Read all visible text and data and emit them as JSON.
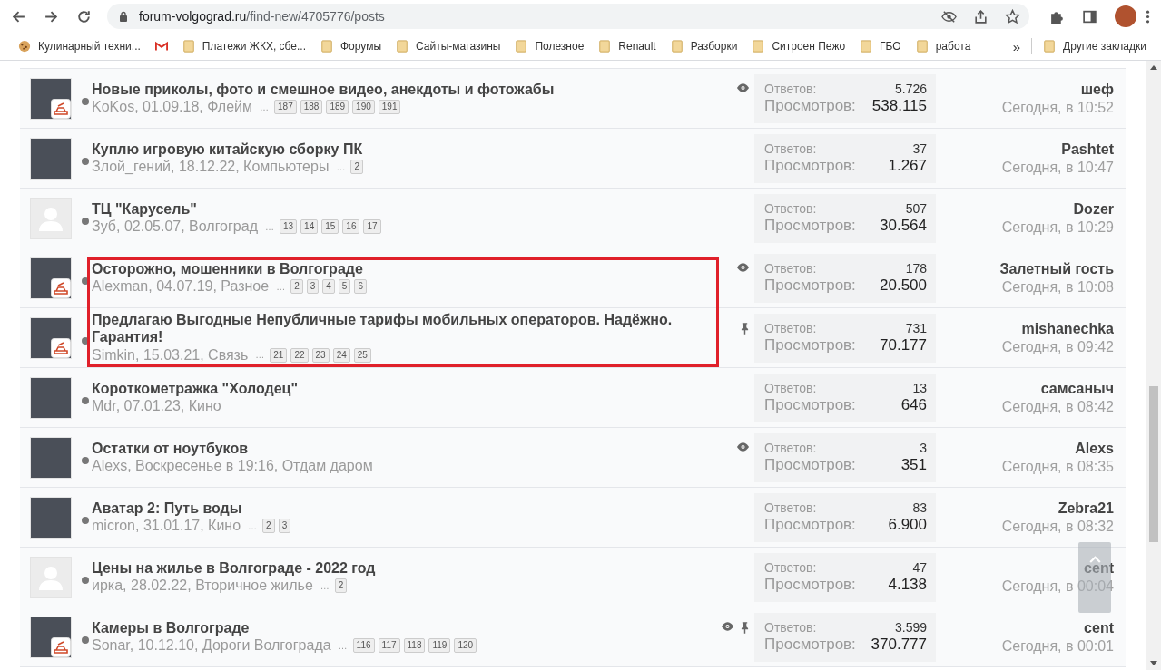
{
  "browser": {
    "url_host": "forum-volgograd.ru",
    "url_path": "/find-new/4705776/posts",
    "bookmarks": [
      {
        "kind": "cookie",
        "label": "Кулинарный техни..."
      },
      {
        "kind": "gmail"
      },
      {
        "kind": "folder",
        "label": "Платежи ЖКХ, сбе..."
      },
      {
        "kind": "folder",
        "label": "Форумы"
      },
      {
        "kind": "folder",
        "label": "Сайты-магазины"
      },
      {
        "kind": "folder",
        "label": "Полезное"
      },
      {
        "kind": "folder",
        "label": "Renault"
      },
      {
        "kind": "folder",
        "label": "Разборки"
      },
      {
        "kind": "folder",
        "label": "Ситроен Пежо"
      },
      {
        "kind": "folder",
        "label": "ГБО"
      },
      {
        "kind": "folder",
        "label": "работа"
      }
    ],
    "more_bookmarks": "»",
    "other_bookmarks": "Другие закладки"
  },
  "threads": [
    {
      "avatar": {
        "kind": "photo"
      },
      "badge": true,
      "title": "Новые приколы, фото и смешное видео, анекдоты и фотожабы",
      "meta": "KoKos, 01.09.18, Флейм",
      "more": "…",
      "pages": [
        "187",
        "188",
        "189",
        "190",
        "191"
      ],
      "watched": true,
      "pinned": false,
      "replies_label": "Ответов:",
      "replies": "5.726",
      "views_label": "Просмотров:",
      "views": "538.115",
      "last_user": "шеф",
      "last_time": "Сегодня, в 10:52",
      "highlighted": false
    },
    {
      "avatar": {
        "kind": "photo"
      },
      "badge": false,
      "title": "Куплю игровую китайскую сборку ПК",
      "meta": "Злой_гений, 18.12.22, Компьютеры",
      "more": "…",
      "pages": [
        "2"
      ],
      "watched": false,
      "pinned": false,
      "replies_label": "Ответов:",
      "replies": "37",
      "views_label": "Просмотров:",
      "views": "1.267",
      "last_user": "Pashtet",
      "last_time": "Сегодня, в 10:47",
      "highlighted": false
    },
    {
      "avatar": {
        "kind": "default"
      },
      "badge": false,
      "title": "ТЦ \"Карусель\"",
      "meta": "Зуб, 02.05.07, Волгоград",
      "more": "…",
      "pages": [
        "13",
        "14",
        "15",
        "16",
        "17"
      ],
      "watched": false,
      "pinned": false,
      "replies_label": "Ответов:",
      "replies": "507",
      "views_label": "Просмотров:",
      "views": "30.564",
      "last_user": "Dozer",
      "last_time": "Сегодня, в 10:29",
      "highlighted": false
    },
    {
      "avatar": {
        "kind": "photo"
      },
      "badge": true,
      "title": "Осторожно, мошенники в Волгограде",
      "meta": "Alexman, 04.07.19, Разное",
      "more": "…",
      "pages": [
        "2",
        "3",
        "4",
        "5",
        "6"
      ],
      "watched": true,
      "pinned": false,
      "replies_label": "Ответов:",
      "replies": "178",
      "views_label": "Просмотров:",
      "views": "20.500",
      "last_user": "Залетный гость",
      "last_time": "Сегодня, в 10:08",
      "highlighted": true
    },
    {
      "avatar": {
        "kind": "photo"
      },
      "badge": true,
      "title": "Предлагаю Выгодные Непубличные тарифы мобильных операторов. Надёжно. Гарантия!",
      "meta": "Simkin, 15.03.21, Связь",
      "more": "…",
      "pages": [
        "21",
        "22",
        "23",
        "24",
        "25"
      ],
      "watched": false,
      "pinned": true,
      "replies_label": "Ответов:",
      "replies": "731",
      "views_label": "Просмотров:",
      "views": "70.177",
      "last_user": "mishanechka",
      "last_time": "Сегодня, в 09:42",
      "highlighted": true
    },
    {
      "avatar": {
        "kind": "photo"
      },
      "badge": false,
      "title": "Короткометражка \"Холодец\"",
      "meta": "Mdr, 07.01.23, Кино",
      "watched": false,
      "pinned": false,
      "replies_label": "Ответов:",
      "replies": "13",
      "views_label": "Просмотров:",
      "views": "646",
      "last_user": "самсаныч",
      "last_time": "Сегодня, в 08:42",
      "highlighted": false
    },
    {
      "avatar": {
        "kind": "photo"
      },
      "badge": false,
      "title": "Остатки от ноутбуков",
      "meta": "Alexs, Воскресенье в 19:16, Отдам даром",
      "watched": true,
      "pinned": false,
      "replies_label": "Ответов:",
      "replies": "3",
      "views_label": "Просмотров:",
      "views": "351",
      "last_user": "Alexs",
      "last_time": "Сегодня, в 08:35",
      "highlighted": false
    },
    {
      "avatar": {
        "kind": "photo"
      },
      "badge": false,
      "title": "Аватар 2: Путь воды",
      "meta": "micron, 31.01.17, Кино",
      "more": "…",
      "pages": [
        "2",
        "3"
      ],
      "watched": false,
      "pinned": false,
      "replies_label": "Ответов:",
      "replies": "83",
      "views_label": "Просмотров:",
      "views": "6.900",
      "last_user": "Zebra21",
      "last_time": "Сегодня, в 08:32",
      "highlighted": false
    },
    {
      "avatar": {
        "kind": "default"
      },
      "badge": false,
      "title": "Цены на жилье в Волгограде - 2022 год",
      "meta": "ирка, 28.02.22, Вторичное жилье",
      "more": "…",
      "pages": [
        "2"
      ],
      "watched": false,
      "pinned": false,
      "replies_label": "Ответов:",
      "replies": "47",
      "views_label": "Просмотров:",
      "views": "4.138",
      "last_user": "cent",
      "last_time": "Сегодня, в 00:04",
      "highlighted": false
    },
    {
      "avatar": {
        "kind": "photo"
      },
      "badge": true,
      "title": "Камеры в Волгограде",
      "meta": "Sonar, 10.12.10, Дороги Волгограда",
      "more": "…",
      "pages": [
        "116",
        "117",
        "118",
        "119",
        "120"
      ],
      "watched": true,
      "pinned": true,
      "replies_label": "Ответов:",
      "replies": "3.599",
      "views_label": "Просмотров:",
      "views": "370.777",
      "last_user": "cent",
      "last_time": "Сегодня, в 00:01",
      "highlighted": false
    }
  ]
}
